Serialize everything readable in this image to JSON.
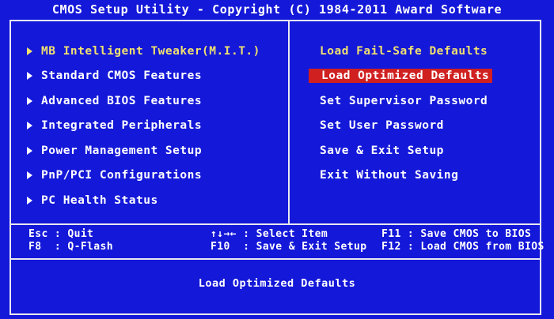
{
  "header": {
    "title": "CMOS Setup Utility - Copyright (C) 1984-2011 Award Software"
  },
  "left_menu": {
    "items": [
      {
        "label": "MB Intelligent Tweaker(M.I.T.)",
        "icon": "triangle-right-icon"
      },
      {
        "label": "Standard CMOS Features",
        "icon": "triangle-right-icon"
      },
      {
        "label": "Advanced BIOS Features",
        "icon": "triangle-right-icon"
      },
      {
        "label": "Integrated Peripherals",
        "icon": "triangle-right-icon"
      },
      {
        "label": "Power Management Setup",
        "icon": "triangle-right-icon"
      },
      {
        "label": "PnP/PCI Configurations",
        "icon": "triangle-right-icon"
      },
      {
        "label": "PC Health Status",
        "icon": "triangle-right-icon"
      }
    ]
  },
  "right_menu": {
    "items": [
      {
        "label": "Load Fail-Safe Defaults"
      },
      {
        "label": "Load Optimized Defaults",
        "selected": true
      },
      {
        "label": "Set Supervisor Password"
      },
      {
        "label": "Set User Password"
      },
      {
        "label": "Save & Exit Setup"
      },
      {
        "label": "Exit Without Saving"
      }
    ]
  },
  "key_help": {
    "col1": [
      "Esc : Quit",
      "F8  : Q-Flash"
    ],
    "col2": [
      "↑↓→← : Select Item",
      "F10  : Save & Exit Setup"
    ],
    "col3": [
      "F11 : Save CMOS to BIOS",
      "F12 : Load CMOS from BIOS"
    ]
  },
  "status": {
    "text": "Load Optimized Defaults"
  },
  "colors": {
    "background": "#1418d8",
    "menu_text": "#f0e070",
    "highlight": "#d02020",
    "border": "#e8e8f0"
  }
}
